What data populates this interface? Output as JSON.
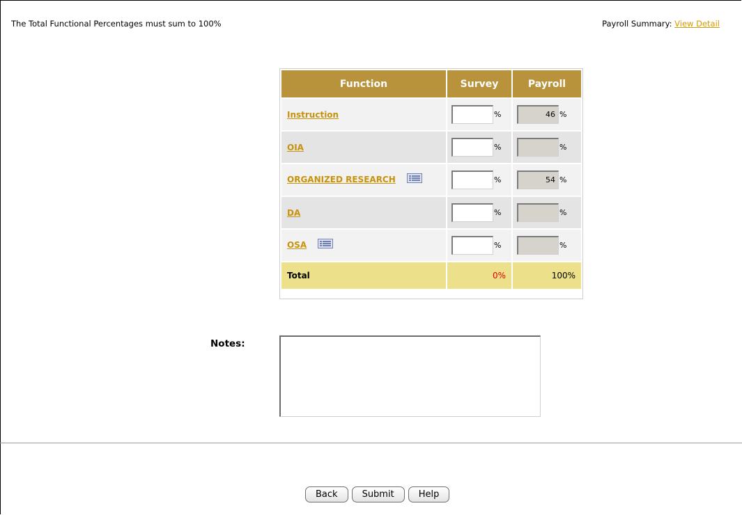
{
  "header": {
    "note": "The Total Functional Percentages must sum to 100%",
    "payroll_summary_label": "Payroll Summary:",
    "view_detail_link": "View Detail"
  },
  "table": {
    "headers": [
      "Function",
      "Survey",
      "Payroll"
    ],
    "rows": [
      {
        "function": "Instruction",
        "survey": "",
        "payroll": "46",
        "has_detail_icon": false
      },
      {
        "function": "OIA",
        "survey": "",
        "payroll": "",
        "has_detail_icon": false
      },
      {
        "function": "ORGANIZED RESEARCH",
        "survey": "",
        "payroll": "54",
        "has_detail_icon": true
      },
      {
        "function": "DA",
        "survey": "",
        "payroll": "",
        "has_detail_icon": false
      },
      {
        "function": "OSA",
        "survey": "",
        "payroll": "",
        "has_detail_icon": true
      }
    ],
    "pct_sign": "%",
    "total_label": "Total",
    "survey_total": "0%",
    "payroll_total": "100%"
  },
  "notes": {
    "label": "Notes:",
    "value": ""
  },
  "buttons": {
    "back": "Back",
    "submit": "Submit",
    "help": "Help"
  },
  "colors": {
    "header_bg": "#b8933b",
    "link": "#c8920a",
    "total_bg": "#ede08a",
    "survey_total_color": "#e00000"
  }
}
